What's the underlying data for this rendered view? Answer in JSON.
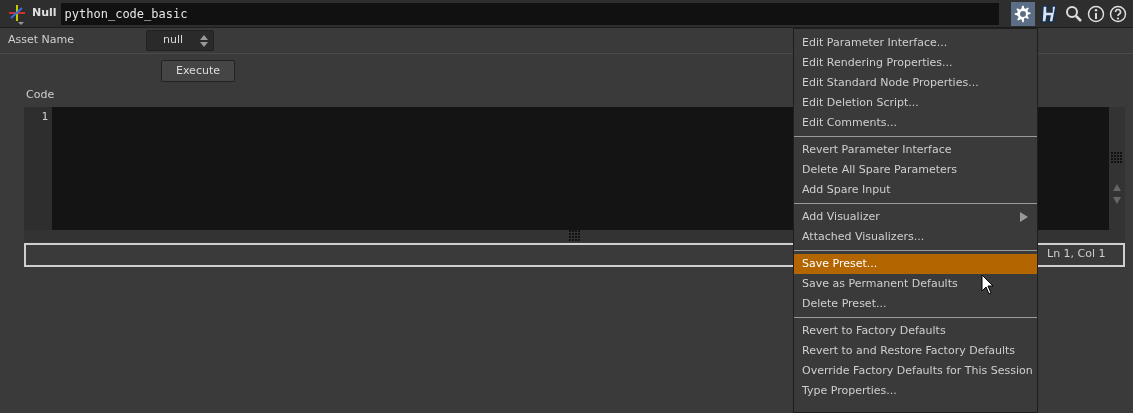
{
  "header": {
    "node_type": "Null",
    "node_name": "python_code_basic"
  },
  "parameters": {
    "asset_name": {
      "label": "Asset Name",
      "value": "null"
    },
    "execute_button": "Execute",
    "code": {
      "label": "Code",
      "line_numbers": [
        "1"
      ],
      "status": "Ln 1, Col 1"
    }
  },
  "menu": {
    "groups": [
      [
        {
          "label": "Edit Parameter Interface...",
          "selected": false,
          "submenu": false
        },
        {
          "label": "Edit Rendering Properties...",
          "selected": false,
          "submenu": false
        },
        {
          "label": "Edit Standard Node Properties...",
          "selected": false,
          "submenu": false
        },
        {
          "label": "Edit Deletion Script...",
          "selected": false,
          "submenu": false
        },
        {
          "label": "Edit Comments...",
          "selected": false,
          "submenu": false
        }
      ],
      [
        {
          "label": "Revert Parameter Interface",
          "selected": false,
          "submenu": false
        },
        {
          "label": "Delete All Spare Parameters",
          "selected": false,
          "submenu": false
        },
        {
          "label": "Add Spare Input",
          "selected": false,
          "submenu": false
        }
      ],
      [
        {
          "label": "Add Visualizer",
          "selected": false,
          "submenu": true
        },
        {
          "label": "Attached Visualizers...",
          "selected": false,
          "submenu": false
        }
      ],
      [
        {
          "label": "Save Preset...",
          "selected": true,
          "submenu": false
        },
        {
          "label": "Save as Permanent Defaults",
          "selected": false,
          "submenu": false
        },
        {
          "label": "Delete Preset...",
          "selected": false,
          "submenu": false
        }
      ],
      [
        {
          "label": "Revert to Factory Defaults",
          "selected": false,
          "submenu": false
        },
        {
          "label": "Revert to and Restore Factory Defaults",
          "selected": false,
          "submenu": false
        },
        {
          "label": "Override Factory Defaults for This Session",
          "selected": false,
          "submenu": false
        },
        {
          "label": "Type Properties...",
          "selected": false,
          "submenu": false
        }
      ]
    ]
  }
}
